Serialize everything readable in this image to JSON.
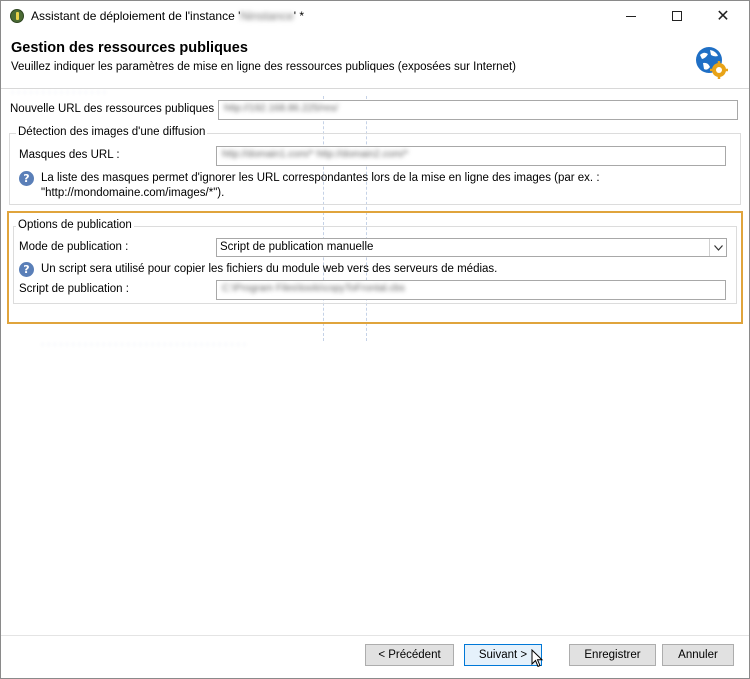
{
  "window": {
    "title_prefix": "Assistant de déploiement de l'instance '",
    "title_blurred": "Ninstance",
    "title_suffix": "' *",
    "controls": {
      "minimize": "minimize-icon",
      "maximize": "maximize-icon",
      "close": "✕"
    }
  },
  "header": {
    "title": "Gestion des ressources publiques",
    "subtitle": "Veuillez indiquer les paramètres de mise en ligne des ressources publiques (exposées sur Internet)",
    "icon": "globe-gear-icon"
  },
  "public_url": {
    "label": "Nouvelle URL des ressources publiques :",
    "value": "http://192.168.86.225/res/"
  },
  "image_detection": {
    "group_title": "Détection des images d'une diffusion",
    "masks_label": "Masques des URL :",
    "masks_value": "http://domain1.com/* http://domain2.com/*",
    "info_line1": "La liste des masques permet d'ignorer les URL correspondantes lors de la mise en ligne des images (par ex. :",
    "info_line2": "\"http://mondomaine.com/images/*\")."
  },
  "publication": {
    "group_title": "Options de publication",
    "mode_label": "Mode de publication :",
    "mode_value": "Script de publication manuelle",
    "info": "Un script sera utilisé pour copier les fichiers du module web vers des serveurs de médias.",
    "script_label": "Script de publication :",
    "script_value": "C:\\Program Files\\tools\\copyToFrontal.cbs"
  },
  "buttons": {
    "prev": "< Précédent",
    "next": "Suivant >",
    "save": "Enregistrer",
    "cancel": "Annuler"
  },
  "colors": {
    "highlight": "#e0a43c",
    "info_icon": "#5a7fb8",
    "primary_button_border": "#0078d7"
  }
}
